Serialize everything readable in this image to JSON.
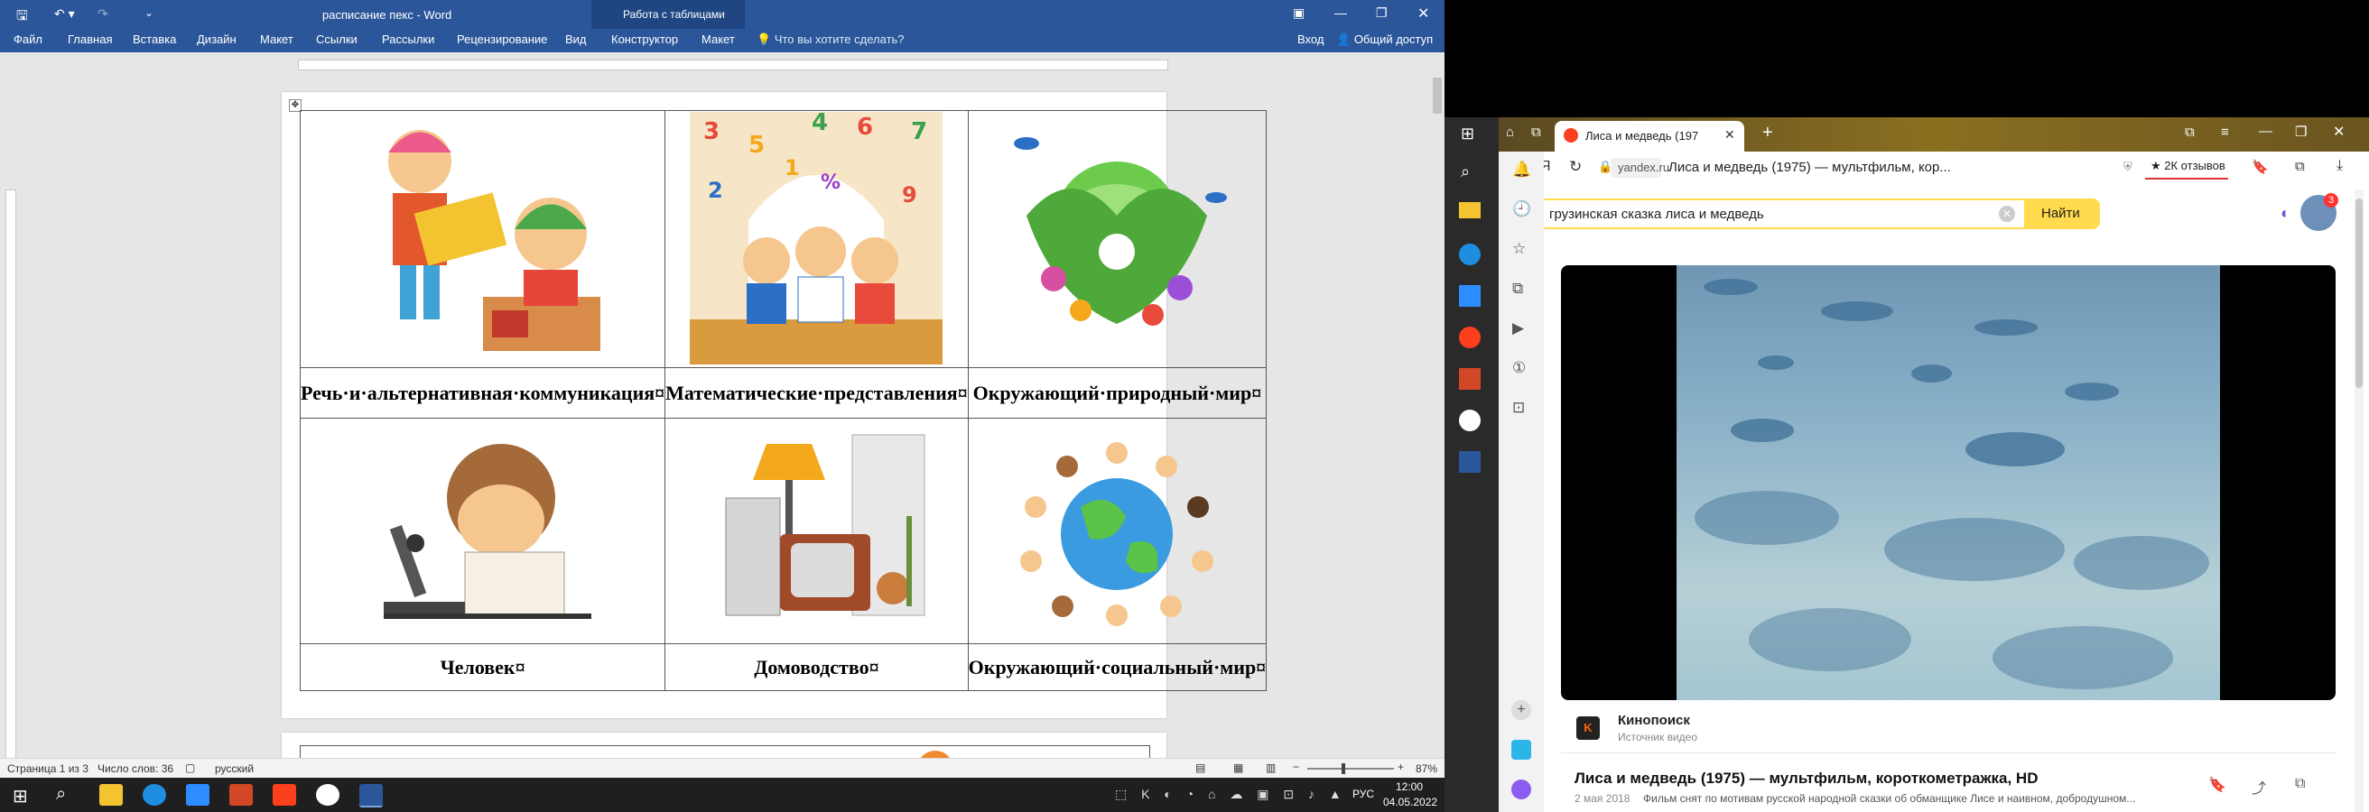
{
  "word": {
    "title": "расписание пекс - Word",
    "context_group": "Работа с таблицами",
    "ribbon_tabs": [
      "Файл",
      "Главная",
      "Вставка",
      "Дизайн",
      "Макет",
      "Ссылки",
      "Рассылки",
      "Рецензирование",
      "Вид",
      "Конструктор",
      "Макет"
    ],
    "tell_me_placeholder": "Что вы хотите сделать?",
    "signin": "Вход",
    "share": "Общий доступ",
    "table_labels": [
      "Речь·и·альтернативная·коммуникация¤",
      "Математические·представления¤",
      "Окружающий·природный·мир¤",
      "Человек¤",
      "Домоводство¤",
      "Окружающий·социальный·мир¤"
    ],
    "status": {
      "page": "Страница 1 из 3",
      "words": "Число слов: 36",
      "language": "русский",
      "zoom": "87%"
    }
  },
  "taskbar": {
    "language": "РУС",
    "time": "12:00",
    "date": "04.05.2022"
  },
  "browser": {
    "tab_title": "Лиса и медведь (197",
    "address_domain": "yandex.ru",
    "address_title": "Лиса и медведь (1975) — мультфильм, кор...",
    "reviews": "★ 2К отзывов",
    "search_query": "грузинская сказка лиса и медведь",
    "search_button": "Найти",
    "notif_count": "3",
    "source_name": "Кинопоиск",
    "source_sub": "Источник видео",
    "result_title": "Лиса и медведь (1975) — мультфильм, короткометражка, HD",
    "result_date": "2 мая 2018",
    "result_snippet": "Фильм снят по мотивам русской народной сказки об обманщике Лисе и наивном, добродушном..."
  },
  "colors": {
    "word_blue": "#2b579a",
    "yandex_yellow": "#ffdb4d",
    "yandex_red": "#fc3f1d"
  }
}
